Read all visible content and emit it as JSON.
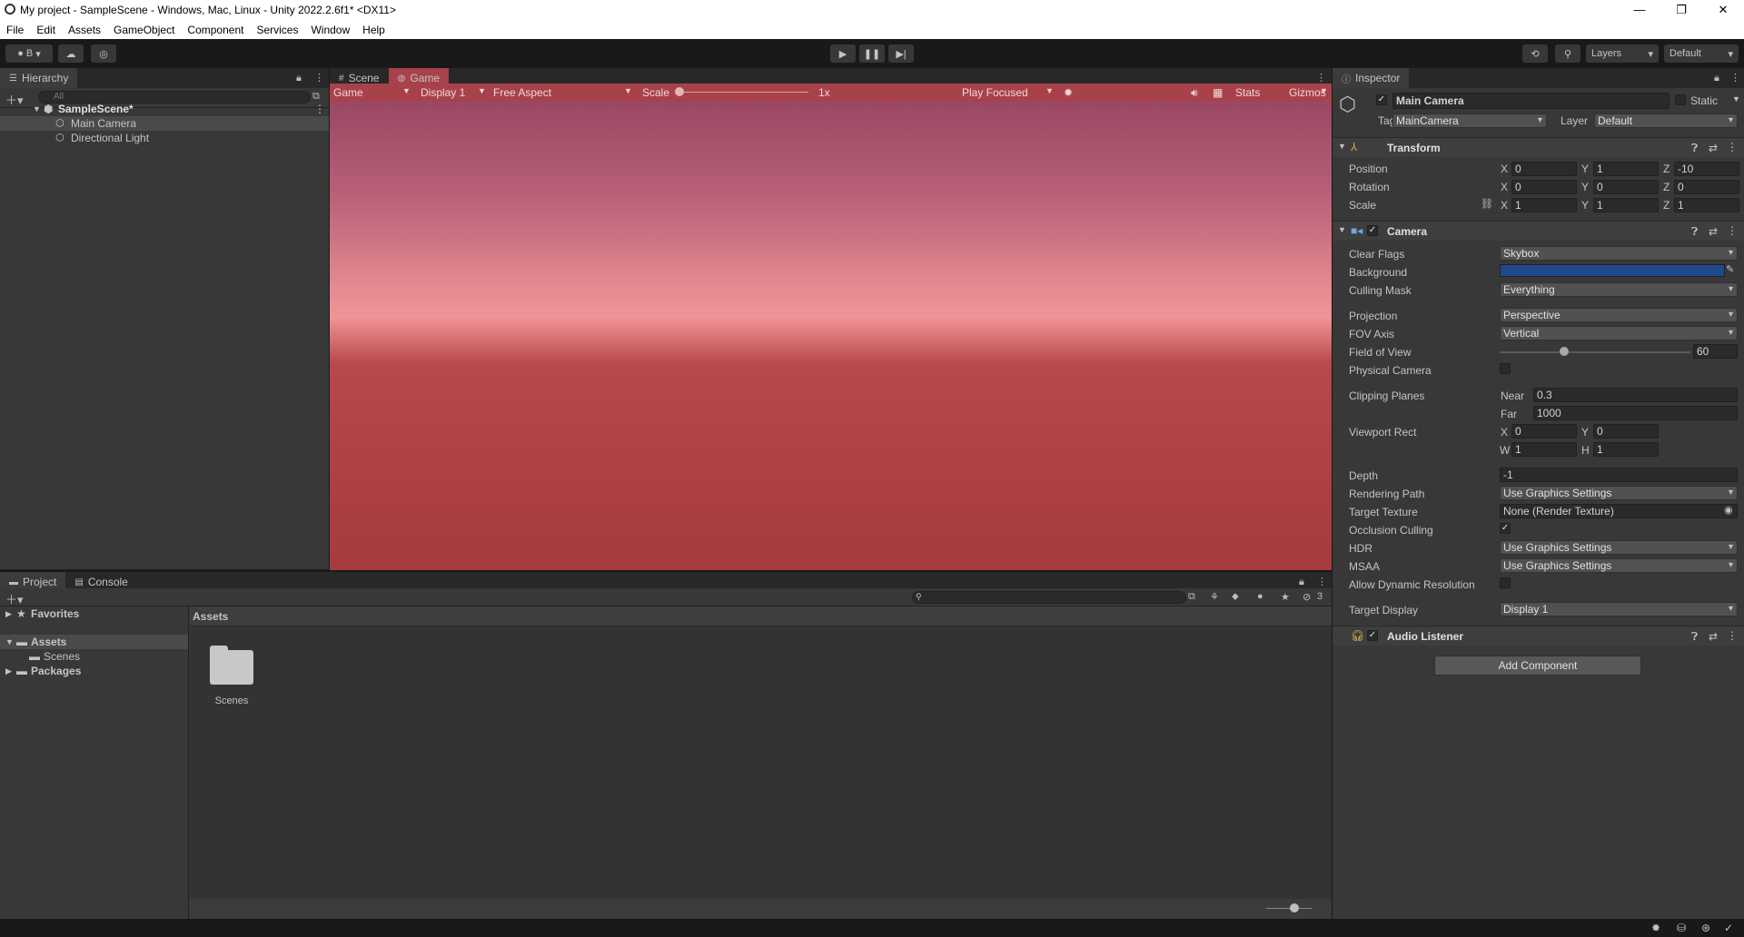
{
  "window": {
    "title": "My project - SampleScene - Windows, Mac, Linux - Unity 2022.2.6f1* <DX11>",
    "minimize": "—",
    "maximize": "❐",
    "close": "✕"
  },
  "menu": [
    "File",
    "Edit",
    "Assets",
    "GameObject",
    "Component",
    "Services",
    "Window",
    "Help"
  ],
  "toolbar": {
    "account": "B",
    "layers": "Layers",
    "layout": "Default"
  },
  "hierarchy": {
    "tab": "Hierarchy",
    "search_placeholder": "All",
    "scene": "SampleScene*",
    "items": [
      "Main Camera",
      "Directional Light"
    ]
  },
  "views": {
    "scene_tab": "Scene",
    "game_tab": "Game"
  },
  "gamebar": {
    "mode": "Game",
    "display": "Display 1",
    "aspect": "Free Aspect",
    "scale_label": "Scale",
    "scale_value": "1x",
    "play_focus": "Play Focused",
    "stats": "Stats",
    "gizmos": "Gizmos"
  },
  "project": {
    "tabs": [
      "Project",
      "Console"
    ],
    "favorites": "Favorites",
    "assets": "Assets",
    "scenes": "Scenes",
    "packages": "Packages",
    "breadcrumb": "Assets",
    "folder_label": "Scenes",
    "hidden_count": "3"
  },
  "inspector": {
    "tab": "Inspector",
    "object_name": "Main Camera",
    "static": "Static",
    "tag_label": "Tag",
    "tag": "MainCamera",
    "layer_label": "Layer",
    "layer": "Default",
    "transform": {
      "title": "Transform",
      "position_label": "Position",
      "rotation_label": "Rotation",
      "scale_label": "Scale",
      "position": {
        "x": "0",
        "y": "1",
        "z": "-10"
      },
      "rotation": {
        "x": "0",
        "y": "0",
        "z": "0"
      },
      "scale": {
        "x": "1",
        "y": "1",
        "z": "1"
      }
    },
    "camera": {
      "title": "Camera",
      "clear_flags_label": "Clear Flags",
      "clear_flags": "Skybox",
      "background_label": "Background",
      "background_color": "#1e4a8c",
      "culling_mask_label": "Culling Mask",
      "culling_mask": "Everything",
      "projection_label": "Projection",
      "projection": "Perspective",
      "fov_axis_label": "FOV Axis",
      "fov_axis": "Vertical",
      "fov_label": "Field of View",
      "fov": "60",
      "physical_label": "Physical Camera",
      "clipping_label": "Clipping Planes",
      "near_label": "Near",
      "near": "0.3",
      "far_label": "Far",
      "far": "1000",
      "viewport_label": "Viewport Rect",
      "vx": "0",
      "vy": "0",
      "vw": "1",
      "vh": "1",
      "depth_label": "Depth",
      "depth": "-1",
      "rendering_path_label": "Rendering Path",
      "rendering_path": "Use Graphics Settings",
      "target_texture_label": "Target Texture",
      "target_texture": "None (Render Texture)",
      "occlusion_label": "Occlusion Culling",
      "hdr_label": "HDR",
      "hdr": "Use Graphics Settings",
      "msaa_label": "MSAA",
      "msaa": "Use Graphics Settings",
      "dynres_label": "Allow Dynamic Resolution",
      "target_display_label": "Target Display",
      "target_display": "Display 1"
    },
    "audio_listener": "Audio Listener",
    "add_component": "Add Component"
  }
}
